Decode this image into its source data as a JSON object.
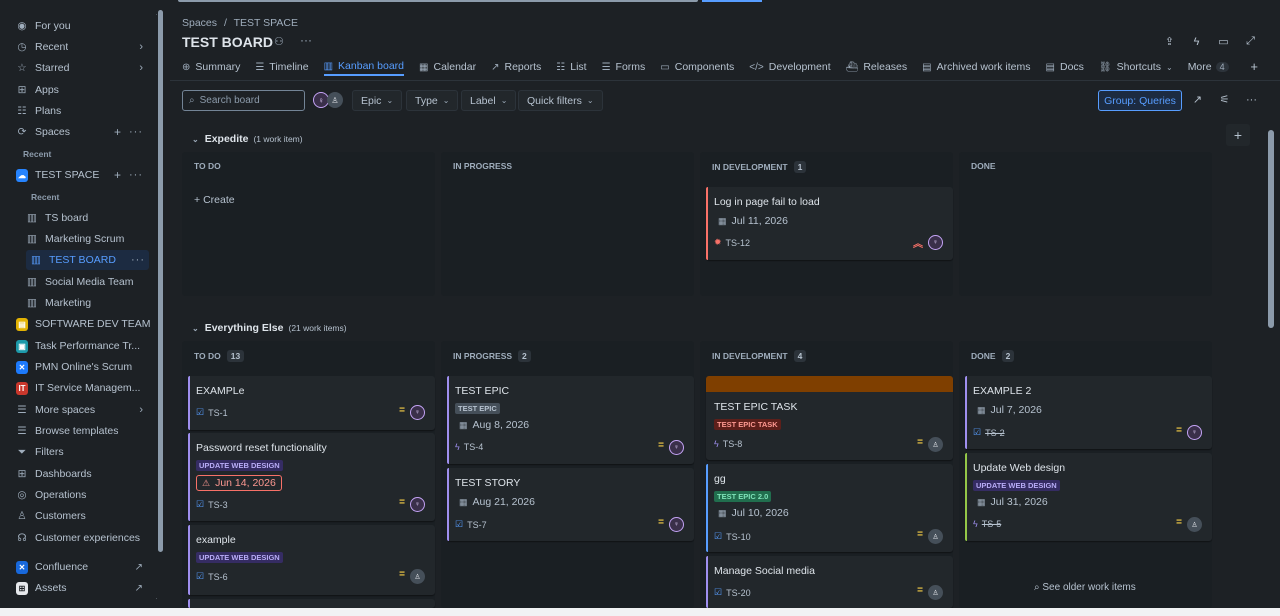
{
  "sidebar": {
    "for_you": "For you",
    "recent": "Recent",
    "starred": "Starred",
    "apps": "Apps",
    "plans": "Plans",
    "spaces": "Spaces",
    "recent_head": "Recent",
    "test_space": "TEST SPACE",
    "recent_sub_head": "Recent",
    "boards": [
      "TS board",
      "Marketing Scrum",
      "TEST BOARD",
      "Social Media Team",
      "Marketing"
    ],
    "spaces_list": [
      "SOFTWARE DEV TEAM",
      "Task Performance Tr...",
      "PMN Online's Scrum",
      "IT Service Managem..."
    ],
    "more_spaces": "More spaces",
    "browse_templates": "Browse templates",
    "filters": "Filters",
    "dashboards": "Dashboards",
    "operations": "Operations",
    "customers": "Customers",
    "customer_experiences": "Customer experiences",
    "confluence": "Confluence",
    "assets": "Assets"
  },
  "header": {
    "breadcrumb": [
      "Spaces",
      "/",
      "TEST SPACE"
    ],
    "title": "TEST BOARD"
  },
  "tabs": [
    {
      "label": "Summary",
      "icon": "⊕"
    },
    {
      "label": "Timeline",
      "icon": "☰"
    },
    {
      "label": "Kanban board",
      "icon": "▥"
    },
    {
      "label": "Calendar",
      "icon": "▦"
    },
    {
      "label": "Reports",
      "icon": "↗"
    },
    {
      "label": "List",
      "icon": "☷"
    },
    {
      "label": "Forms",
      "icon": "☰"
    },
    {
      "label": "Components",
      "icon": "▭"
    },
    {
      "label": "Development",
      "icon": "</>"
    },
    {
      "label": "Releases",
      "icon": "⛴"
    },
    {
      "label": "Archived work items",
      "icon": "▤"
    },
    {
      "label": "Docs",
      "icon": "▤"
    },
    {
      "label": "Shortcuts",
      "icon": "🔗"
    },
    {
      "label": "More",
      "icon": ""
    }
  ],
  "more_count": "4",
  "toolbar": {
    "search_placeholder": "Search board",
    "epic": "Epic",
    "type": "Type",
    "label": "Label",
    "quick_filters": "Quick filters",
    "group": "Group: Queries"
  },
  "lanes": {
    "expedite": {
      "title": "Expedite",
      "sub": "(1 work item)"
    },
    "else": {
      "title": "Everything Else",
      "sub": "(21 work items)"
    }
  },
  "columns": {
    "todo": "TO DO",
    "inprogress": "IN PROGRESS",
    "indev": "IN DEVELOPMENT",
    "done": "DONE"
  },
  "counts": {
    "exp_indev": "1",
    "todo": "13",
    "inprogress": "2",
    "indev": "4",
    "done": "2"
  },
  "create_label": "Create",
  "cards": {
    "exp1": {
      "title": "Log in page fail to load",
      "date": "Jul 11, 2026",
      "key": "TS-12"
    },
    "t1": {
      "title": "EXAMPLe",
      "key": "TS-1"
    },
    "t2": {
      "title": "Password reset functionality",
      "label": "UPDATE WEB DESIGN",
      "date": "Jun 14, 2026",
      "key": "TS-3"
    },
    "t3": {
      "title": "example",
      "label": "UPDATE WEB DESIGN",
      "key": "TS-6"
    },
    "p1": {
      "title": "TEST EPIC",
      "label": "TEST EPIC",
      "date": "Aug 8, 2026",
      "key": "TS-4"
    },
    "p2": {
      "title": "TEST STORY",
      "date": "Aug 21, 2026",
      "key": "TS-7"
    },
    "d1": {
      "title": "TEST EPIC TASK",
      "label": "TEST EPIC TASK",
      "key": "TS-8"
    },
    "d2": {
      "title": "gg",
      "label": "TEST EPIC 2.0",
      "date": "Jul 10, 2026",
      "key": "TS-10"
    },
    "d3": {
      "title": "Manage Social media",
      "key": "TS-20"
    },
    "n1": {
      "title": "EXAMPLE 2",
      "date": "Jul 7, 2026",
      "key": "TS-2"
    },
    "n2": {
      "title": "Update Web design",
      "label": "UPDATE WEB DESIGN",
      "date": "Jul 31, 2026",
      "key": "TS-5"
    }
  },
  "see_older": "See older work items",
  "colors": {
    "accent": "#579dff",
    "purple_label": "#9f8fef",
    "epic_bar": "#7f3f00",
    "bug": "#f87168",
    "medium_priority": "#f5cd47"
  }
}
